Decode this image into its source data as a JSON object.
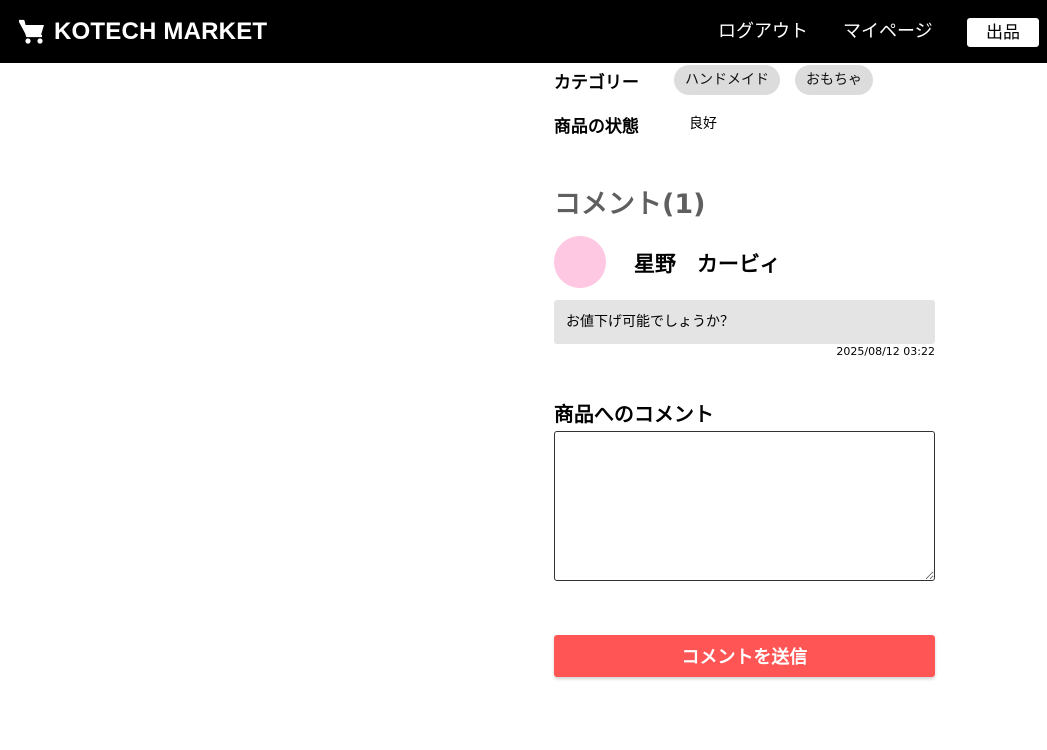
{
  "header": {
    "brand": "KOTECH MARKET",
    "brand_icon": "shopping-cart-icon",
    "nav": {
      "logout": "ログアウト",
      "mypage": "マイページ",
      "sell": "出品"
    }
  },
  "item": {
    "category_label": "カテゴリー",
    "categories": [
      "ハンドメイド",
      "おもちゃ"
    ],
    "condition_label": "商品の状態",
    "condition": "良好"
  },
  "comments": {
    "heading": "コメント(1)",
    "list": [
      {
        "user": "星野　カービィ",
        "avatar_color": "#ffc8e2",
        "text": "お値下げ可能でしょうか？",
        "datetime": "2025/08/12 03:22"
      }
    ]
  },
  "comment_form": {
    "label": "商品へのコメント",
    "value": "",
    "submit_label": "コメントを送信"
  },
  "colors": {
    "header_bg": "#000000",
    "submit_bg": "#ff5555",
    "tag_bg": "#dcdcdc",
    "bubble_bg": "#e4e4e4"
  }
}
